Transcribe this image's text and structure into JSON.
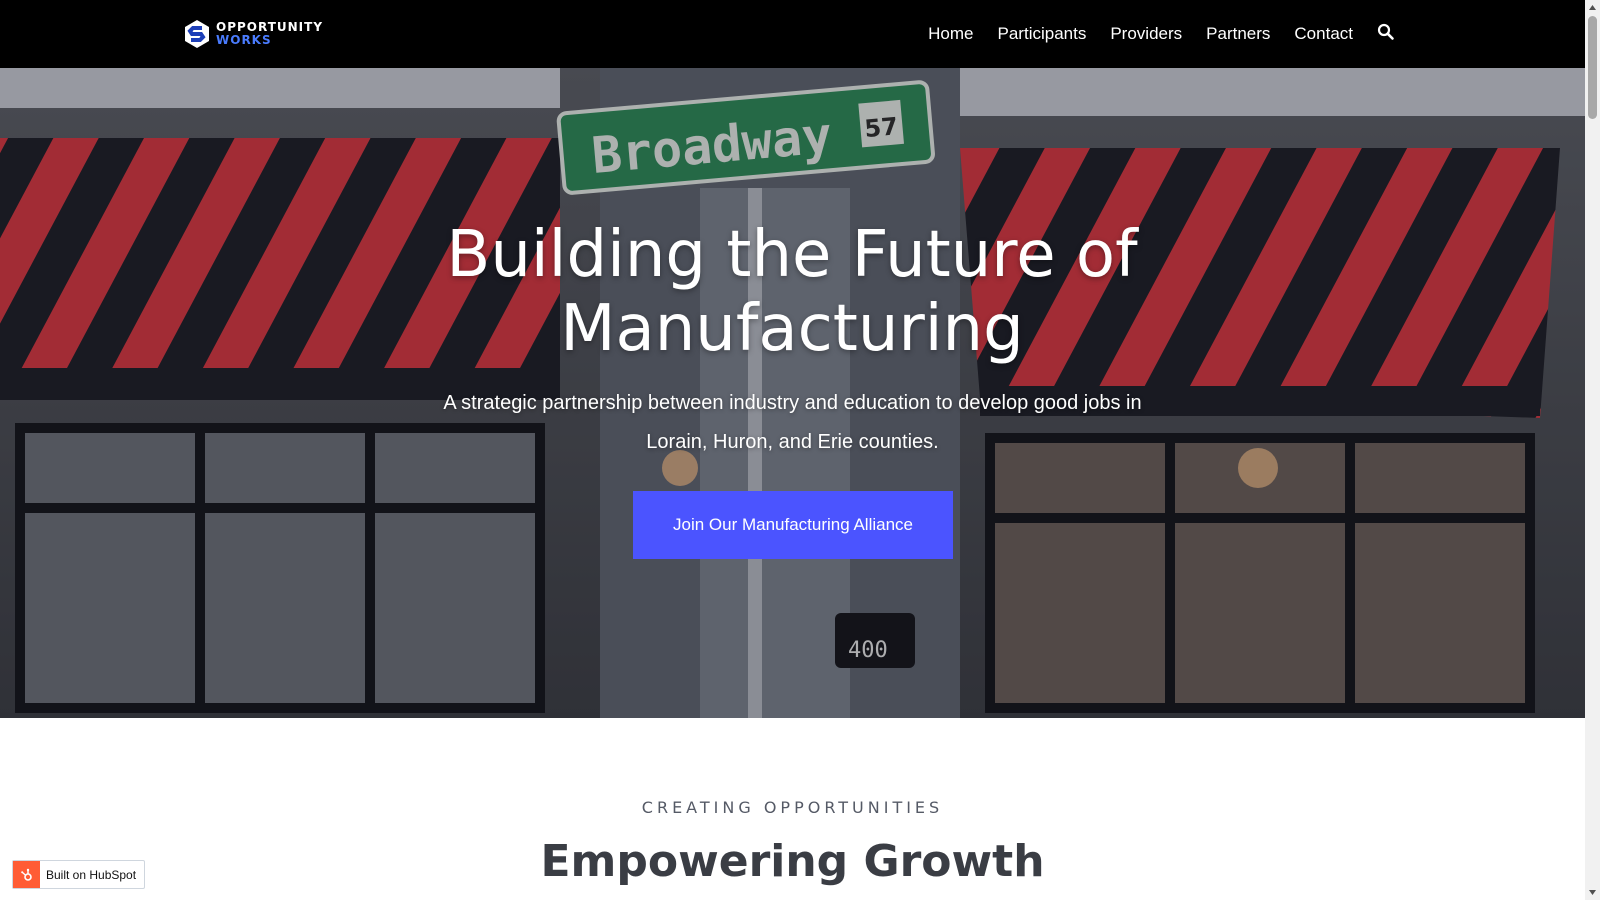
{
  "brand": {
    "name_line1": "OPPORTUNITY",
    "name_line2": "WORKS",
    "logo_icon": "hexagon-s-logo"
  },
  "nav": {
    "items": [
      "Home",
      "Participants",
      "Providers",
      "Partners",
      "Contact"
    ],
    "search_icon": "search-icon"
  },
  "hero": {
    "title": "Building the Future of Manufacturing",
    "subtitle": "A strategic partnership between industry and education to develop good jobs in Lorain, Huron, and Erie counties.",
    "cta_label": "Join Our Manufacturing Alliance",
    "background": {
      "street_sign": "Broadway",
      "route_number": "57",
      "address_number": "400"
    }
  },
  "section": {
    "eyebrow": "CREATING OPPORTUNITIES",
    "title": "Empowering Growth"
  },
  "badge": {
    "label": "Built on HubSpot"
  },
  "colors": {
    "nav_bg": "#000000",
    "accent_button": "#4b54ff",
    "logo_blue": "#4a7cff",
    "hubspot_orange": "#ff5c35",
    "awning_red": "#d8353f"
  }
}
